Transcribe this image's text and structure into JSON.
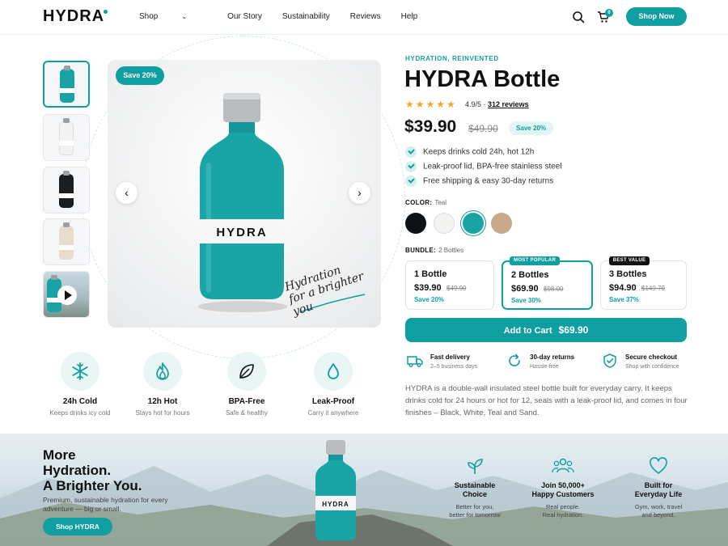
{
  "header": {
    "logo": "HYDRA",
    "nav": [
      {
        "label": "Shop",
        "has_dropdown": true
      },
      {
        "label": "Our Story"
      },
      {
        "label": "Sustainability"
      },
      {
        "label": "Reviews"
      },
      {
        "label": "Help"
      }
    ],
    "cart_count": "0",
    "cta_label": "Shop Now"
  },
  "gallery": {
    "save_badge": "Save 20%",
    "bottle_label": "HYDRA",
    "tagline_line1": "Hydration",
    "tagline_line2": "for a brighter you",
    "thumbnails": [
      {
        "color": "#1aa3a5",
        "active": true
      },
      {
        "color": "#f2f2f2"
      },
      {
        "color": "#1c1d1f"
      },
      {
        "color": "#e8dccb"
      },
      {
        "color": "#1aa3a5",
        "video": true
      }
    ]
  },
  "features": [
    {
      "icon": "snowflake-icon",
      "title": "24h Cold",
      "sub": "Keeps drinks icy cold"
    },
    {
      "icon": "flame-icon",
      "title": "12h Hot",
      "sub": "Stays hot for hours"
    },
    {
      "icon": "leaf-icon",
      "title": "BPA-Free",
      "sub": "Safe & healthy"
    },
    {
      "icon": "droplet-icon",
      "title": "Leak-Proof",
      "sub": "Carry it anywhere"
    }
  ],
  "product": {
    "eyebrow": "HYDRATION, REINVENTED",
    "title": "HYDRA Bottle",
    "stars": "★★★★★",
    "rating": "4.9/5 ·",
    "reviews": "312 reviews",
    "price": "$39.90",
    "old_price": "$49.90",
    "save": "Save 20%",
    "bullets": [
      "Keeps drinks cold 24h, hot 12h",
      "Leak-proof lid, BPA-free stainless steel",
      "Free shipping & easy 30-day returns"
    ],
    "color_label": "COLOR:",
    "color_value": "Teal",
    "swatches": [
      "#0e1216",
      "#f3f3f1",
      "#1aa3a5",
      "#c8a98b"
    ],
    "bundle_label": "BUNDLE:",
    "bundle_value": "2 Bottles",
    "bundles": [
      {
        "name": "1 Bottle",
        "price": "$39.90",
        "old": "$49.90",
        "save": "Save 20%",
        "tag": ""
      },
      {
        "name": "2 Bottles",
        "price": "$69.90",
        "old": "$98.00",
        "save": "Save 30%",
        "tag": "MOST POPULAR"
      },
      {
        "name": "3 Bottles",
        "price": "$94.90",
        "old": "$149.70",
        "save": "Save 37%",
        "tag": "BEST VALUE"
      }
    ],
    "cart_label": "Add to Cart",
    "cart_price": "$69.90",
    "trust": [
      {
        "icon": "truck-icon",
        "title": "Fast delivery",
        "sub": "2–5 business days"
      },
      {
        "icon": "refresh-icon",
        "title": "30-day returns",
        "sub": "Hassle-free"
      },
      {
        "icon": "shield-check-icon",
        "title": "Secure checkout",
        "sub": "Shop with confidence"
      }
    ],
    "description": "HYDRA is a double-wall insulated steel bottle built for everyday carry. It keeps drinks cold for 24 hours or hot for 12, seals with a leak-proof lid, and comes in four finishes – Black, White, Teal and Sand."
  },
  "banner": {
    "headline_1": "More",
    "headline_2": "Hydration.",
    "headline_3": "A Brighter You.",
    "sub": "Premium, sustainable hydration for every adventure — big or small.",
    "cta": "Shop HYDRA",
    "bottle_label": "HYDRA",
    "features": [
      {
        "icon": "sprout-icon",
        "title_1": "Sustainable",
        "title_2": "Choice",
        "sub_1": "Better for you,",
        "sub_2": "better for tomorrow"
      },
      {
        "icon": "people-icon",
        "title_1": "Join 50,000+",
        "title_2": "Happy Customers",
        "sub_1": "Real people.",
        "sub_2": "Real hydration."
      },
      {
        "icon": "heart-icon",
        "title_1": "Built for",
        "title_2": "Everyday Life",
        "sub_1": "Gym, work, travel",
        "sub_2": "and beyond."
      }
    ]
  },
  "colors": {
    "accent": "#0f9fa0",
    "accent_light": "#e3f4f4",
    "star": "#f6a623"
  }
}
